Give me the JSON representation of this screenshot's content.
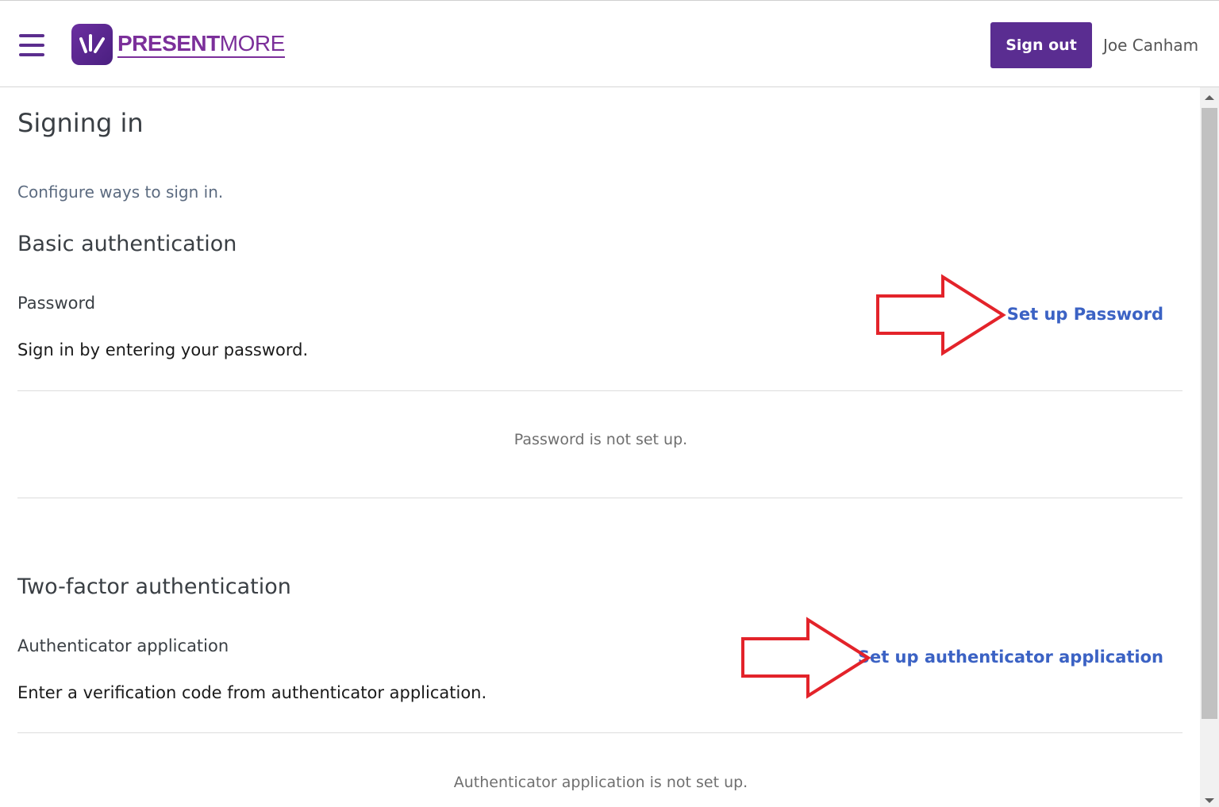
{
  "header": {
    "logo": {
      "bold": "PRESENT",
      "light": "MORE"
    },
    "signout_label": "Sign out",
    "username": "Joe Canham",
    "brand_color": "#5a2d91"
  },
  "icons": {
    "menu": "hamburger-menu-icon",
    "logo": "present-more-logo-icon",
    "annotation": "red-outline-arrow-icon"
  },
  "page": {
    "title": "Signing in",
    "subtitle": "Configure ways to sign in."
  },
  "sections": {
    "basic": {
      "title": "Basic authentication",
      "method": "Password",
      "description": "Sign in by entering your password.",
      "action": "Set up Password",
      "status": "Password is not set up."
    },
    "two_factor": {
      "title": "Two-factor authentication",
      "method": "Authenticator application",
      "description": "Enter a verification code from authenticator application.",
      "action": "Set up authenticator application",
      "status": "Authenticator application is not set up."
    }
  },
  "colors": {
    "link": "#3b62c4",
    "annotation_arrow": "#e3232a"
  }
}
